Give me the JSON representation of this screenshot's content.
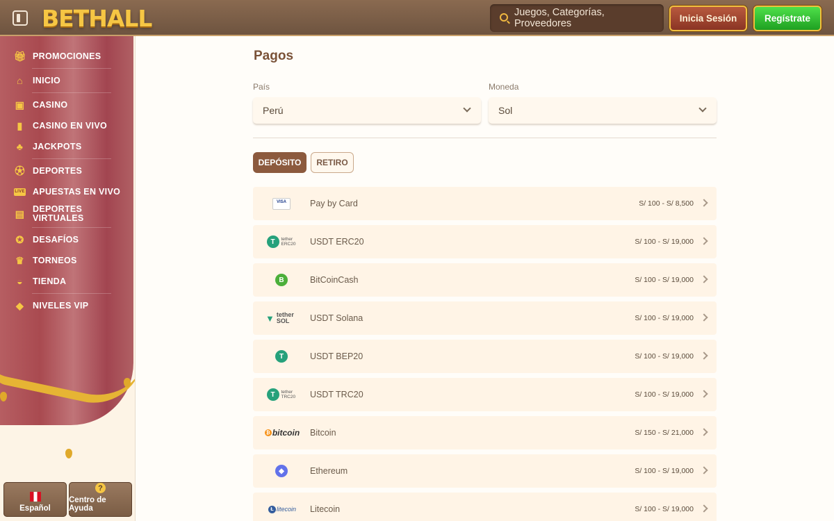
{
  "header": {
    "logo": "BETHALL",
    "search_placeholder": "Juegos, Categorías, Proveedores",
    "login_label": "Inicia Sesión",
    "register_label": "Regístrate"
  },
  "sidebar": {
    "items": [
      {
        "label": "PROMOCIONES",
        "icon": "gift-icon"
      },
      {
        "label": "INICIO",
        "icon": "home-icon"
      },
      {
        "label": "CASINO",
        "icon": "slot-machine-icon"
      },
      {
        "label": "CASINO EN VIVO",
        "icon": "cards-icon"
      },
      {
        "label": "JACKPOTS",
        "icon": "clover-icon"
      },
      {
        "label": "DEPORTES",
        "icon": "ball-icon"
      },
      {
        "label": "APUESTAS EN VIVO",
        "icon": "live-icon"
      },
      {
        "label": "DEPORTES VIRTUALES",
        "icon": "virtual-sports-icon"
      },
      {
        "label": "DESAFÍOS",
        "icon": "badge-icon"
      },
      {
        "label": "TORNEOS",
        "icon": "trophy-icon"
      },
      {
        "label": "TIENDA",
        "icon": "shop-bag-icon"
      },
      {
        "label": "NIVELES VIP",
        "icon": "diamond-icon"
      }
    ],
    "live_badge": "LIVE",
    "language_label": "Español",
    "help_label": "Centro de Ayuda"
  },
  "main": {
    "title": "Pagos",
    "country_label": "País",
    "country_value": "Perú",
    "currency_label": "Moneda",
    "currency_value": "Sol",
    "tab_deposit": "DEPÓSITO",
    "tab_withdraw": "RETIRO",
    "methods": [
      {
        "name": "Pay by Card",
        "range": "S/ 100 - S/ 8,500",
        "logo_text": "VISA"
      },
      {
        "name": "USDT ERC20",
        "range": "S/ 100 - S/ 19,000",
        "logo_text": "tether ERC20"
      },
      {
        "name": "BitCoinCash",
        "range": "S/ 100 - S/ 19,000",
        "logo_text": "B"
      },
      {
        "name": "USDT Solana",
        "range": "S/ 100 - S/ 19,000",
        "logo_text": "tether SOL"
      },
      {
        "name": "USDT BEP20",
        "range": "S/ 100 - S/ 19,000",
        "logo_text": "T"
      },
      {
        "name": "USDT TRC20",
        "range": "S/ 100 - S/ 19,000",
        "logo_text": "tether TRC20"
      },
      {
        "name": "Bitcoin",
        "range": "S/ 150 - S/ 21,000",
        "logo_text": "bitcoin"
      },
      {
        "name": "Ethereum",
        "range": "S/ 100 - S/ 19,000",
        "logo_text": "◆"
      },
      {
        "name": "Litecoin",
        "range": "S/ 100 - S/ 19,000",
        "logo_text": "litecoin"
      }
    ]
  },
  "colors": {
    "accent_brown": "#8c5a3e",
    "gold": "#f6c644",
    "register_green": "#22b02a",
    "row_bg": "#fff4e6"
  }
}
